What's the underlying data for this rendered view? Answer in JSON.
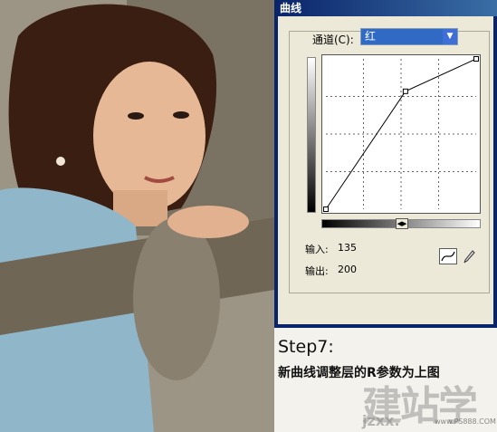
{
  "dialog": {
    "title": "曲线",
    "channel_label": "通道(C):",
    "channel_value": "红",
    "input_label": "输入:",
    "input_value": "135",
    "output_label": "输出:",
    "output_value": "200"
  },
  "curve": {
    "points": [
      [
        0,
        0
      ],
      [
        135,
        200
      ],
      [
        255,
        255
      ]
    ],
    "range": [
      0,
      255
    ]
  },
  "caption": {
    "step_title": "Step7:",
    "step_description": "新曲线调整层的R参数为上图"
  },
  "watermark": {
    "large_text": "建站学",
    "url_text": "jzxx.",
    "small_text": "www.PS888.COM"
  },
  "colors": {
    "title_bar": "#0a246a",
    "dialog_bg": "#ece9d8",
    "select_highlight": "#316ac5"
  }
}
